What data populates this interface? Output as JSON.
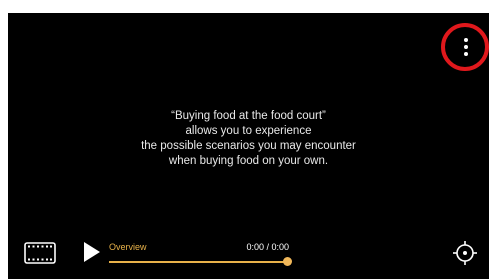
{
  "video": {
    "caption_lines": [
      "“Buying food at the food court”",
      "allows you to experience",
      "the possible scenarios you may encounter",
      "when buying food on your own."
    ]
  },
  "toolbar": {
    "more_icon": "vertical-ellipsis-icon",
    "highlight_color": "#e0181c"
  },
  "controls": {
    "chapter_label": "Overview",
    "time": "0:00 / 0:00",
    "progress": 1.0,
    "accent_color": "#e8b24a",
    "icons": {
      "film": "filmstrip-icon",
      "play": "play-icon",
      "target": "crosshair-icon"
    }
  }
}
